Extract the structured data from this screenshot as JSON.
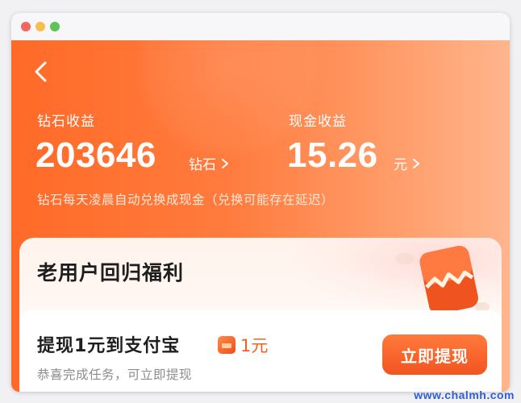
{
  "diamond": {
    "label": "钻石收益",
    "value": "203646",
    "unit": "钻石"
  },
  "cash": {
    "label": "现金收益",
    "value": "15.26",
    "unit": "元"
  },
  "note": "钻石每天凌晨自动兑换成现金（兑换可能存在延迟）",
  "card": {
    "title": "老用户回归福利",
    "task_title": "提现1元到支付宝",
    "reward_amount": "1元",
    "task_sub": "恭喜完成任务，可立即提现",
    "button_label": "立即提现"
  },
  "watermark": "www.chalmh.com",
  "colors": {
    "accent": "#ff6a28",
    "button": "#f2541f",
    "reward_text": "#f0601f"
  },
  "icons": {
    "back": "chevron-left-icon",
    "arrow": "chevron-right-icon",
    "reward": "red-packet-icon"
  }
}
